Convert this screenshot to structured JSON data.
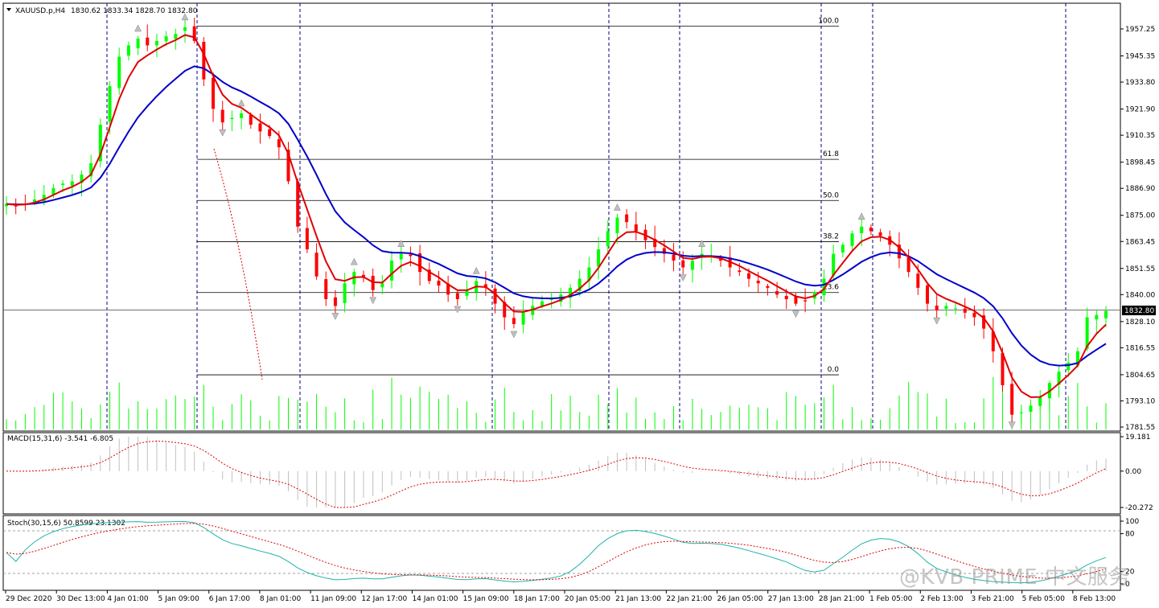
{
  "symbol_header": {
    "symbol": "XAUUSD.p,H4",
    "ohlc": "1830.62 1833.34 1828.70 1832.80"
  },
  "price_axis": {
    "ticks": [
      "1957.25",
      "1945.35",
      "1933.80",
      "1921.90",
      "1910.35",
      "1898.45",
      "1886.90",
      "1875.00",
      "1863.45",
      "1851.55",
      "1840.00",
      "1828.10",
      "1816.55",
      "1804.65",
      "1793.10",
      "1781.55"
    ],
    "last_price": "1832.80"
  },
  "time_axis": {
    "labels": [
      "29 Dec 2020",
      "30 Dec 13:00",
      "4 Jan 01:00",
      "5 Jan 09:00",
      "6 Jan 17:00",
      "8 Jan 01:00",
      "11 Jan 09:00",
      "12 Jan 17:00",
      "14 Jan 01:00",
      "15 Jan 09:00",
      "18 Jan 17:00",
      "20 Jan 05:00",
      "21 Jan 13:00",
      "22 Jan 21:00",
      "26 Jan 05:00",
      "27 Jan 13:00",
      "28 Jan 21:00",
      "1 Feb 05:00",
      "2 Feb 13:00",
      "3 Feb 21:00",
      "5 Feb 05:00",
      "8 Feb 13:00"
    ]
  },
  "fibonacci": {
    "levels": [
      "100.0",
      "61.8",
      "50.0",
      "38.2",
      "23.6",
      "0.0"
    ]
  },
  "macd_panel": {
    "title": "MACD(15,31,6) -3.541 -6.805",
    "ticks": [
      "19.181",
      "0.00",
      "-20.272"
    ]
  },
  "stoch_panel": {
    "title": "Stoch(30,15,6) 50.8599 23.1302",
    "ticks": [
      "100",
      "80",
      "20",
      "0"
    ]
  },
  "watermark": "@KVB PRIME 中文服务",
  "colors": {
    "bull": "#00ff00",
    "bear": "#ff0000",
    "ma_fast": "#e00000",
    "ma_slow": "#0000cc",
    "stoch_main": "#20b2aa",
    "signal": "#e00000",
    "grid_dash": "#000080"
  },
  "chart_data": {
    "type": "candlestick",
    "title": "XAUUSD.p,H4",
    "ylim": [
      1781.55,
      1957.25
    ],
    "last_close": 1832.8,
    "period_separators": [
      "4 Jan",
      "6 Jan",
      "8 Jan",
      "15 Jan",
      "20 Jan",
      "22 Jan",
      "27 Jan",
      "1 Feb",
      "5 Feb"
    ],
    "fibonacci_retracement": {
      "high": 1958.5,
      "low": 1804.6
    },
    "close_profile": [
      1880,
      1879,
      1880,
      1882,
      1884,
      1887,
      1889,
      1890,
      1893,
      1898,
      1915,
      1932,
      1945,
      1950,
      1953,
      1950,
      1952,
      1954,
      1955,
      1958,
      1952,
      1935,
      1922,
      1916,
      1918,
      1920,
      1915,
      1912,
      1910,
      1905,
      1890,
      1870,
      1860,
      1848,
      1838,
      1835,
      1845,
      1850,
      1848,
      1842,
      1845,
      1855,
      1858,
      1857,
      1850,
      1846,
      1844,
      1840,
      1838,
      1842,
      1846,
      1843,
      1836,
      1830,
      1827,
      1832,
      1835,
      1837,
      1838,
      1840,
      1843,
      1847,
      1852,
      1860,
      1868,
      1874,
      1872,
      1868,
      1864,
      1861,
      1858,
      1855,
      1852,
      1855,
      1858,
      1857,
      1855,
      1852,
      1850,
      1847,
      1845,
      1843,
      1840,
      1838,
      1836,
      1837,
      1841,
      1847,
      1858,
      1862,
      1867,
      1870,
      1868,
      1866,
      1862,
      1856,
      1850,
      1843,
      1836,
      1833,
      1835,
      1834,
      1832,
      1830,
      1825,
      1815,
      1800,
      1787,
      1788,
      1791,
      1795,
      1801,
      1806,
      1810,
      1815,
      1830,
      1831,
      1832.8
    ],
    "macd": {
      "params": "15,31,6",
      "main": -3.541,
      "signal": -6.805,
      "ylim": [
        -20.272,
        19.181
      ]
    },
    "stochastic": {
      "params": "30,15,6",
      "k": 50.8599,
      "d": 23.1302,
      "levels": [
        20,
        80
      ],
      "ylim": [
        0,
        100
      ]
    }
  }
}
